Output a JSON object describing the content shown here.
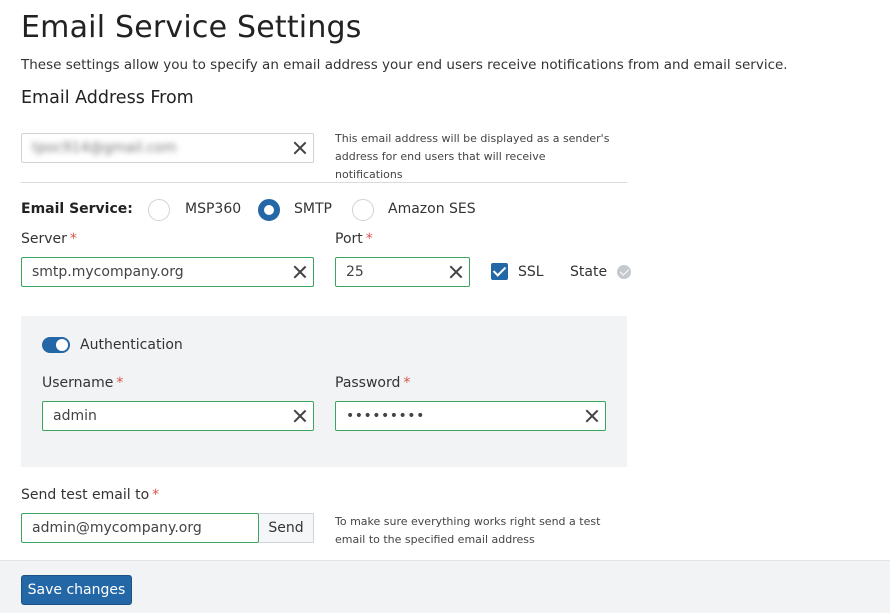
{
  "header": {
    "title": "Email Service Settings",
    "description": "These settings allow you to specify an email address your end users receive notifications from and email service."
  },
  "email_from": {
    "section_title": "Email Address From",
    "value": "tpoc914@gmail.com",
    "hint": "This email address will be displayed as a sender's address for end users that will receive notifications"
  },
  "email_service": {
    "label": "Email Service:",
    "options": [
      {
        "label": "MSP360",
        "checked": false
      },
      {
        "label": "SMTP",
        "checked": true
      },
      {
        "label": "Amazon SES",
        "checked": false
      }
    ]
  },
  "server": {
    "label": "Server",
    "required_mark": "*",
    "value": "smtp.mycompany.org"
  },
  "port": {
    "label": "Port",
    "required_mark": "*",
    "value": "25"
  },
  "ssl": {
    "label": "SSL",
    "checked": true
  },
  "state": {
    "label": "State",
    "icon": "check-circle-icon"
  },
  "authentication": {
    "toggle_label": "Authentication",
    "enabled": true,
    "username": {
      "label": "Username",
      "required_mark": "*",
      "value": "admin"
    },
    "password": {
      "label": "Password",
      "required_mark": "*",
      "value": "•••••••••"
    }
  },
  "test_email": {
    "label": "Send test email to",
    "required_mark": "*",
    "value": "admin@mycompany.org",
    "send_label": "Send",
    "hint": "To make sure everything works right send a test email to the specified email address"
  },
  "footer": {
    "save_label": "Save changes"
  },
  "colors": {
    "accent": "#2467a6",
    "valid_border": "#3aa55c",
    "required": "#d9534f"
  }
}
